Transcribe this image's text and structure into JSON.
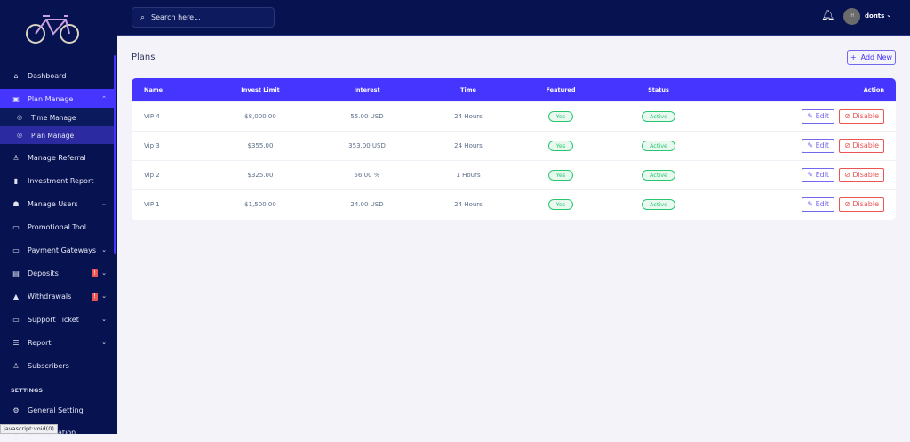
{
  "sidebar": {
    "items": [
      {
        "label": "Dashboard",
        "icon": "home-icon"
      },
      {
        "label": "Plan Manage",
        "icon": "clipboard-icon"
      },
      {
        "label": "Time Manage",
        "icon": "dot-circle-icon"
      },
      {
        "label": "Plan Manage",
        "icon": "dot-circle-icon"
      },
      {
        "label": "Manage Referral",
        "icon": "referral-icon"
      },
      {
        "label": "Investment Report",
        "icon": "chart-icon"
      },
      {
        "label": "Manage Users",
        "icon": "users-icon"
      },
      {
        "label": "Promotional Tool",
        "icon": "promo-icon"
      },
      {
        "label": "Payment Gateways",
        "icon": "credit-card-icon"
      },
      {
        "label": "Deposits",
        "icon": "file-icon",
        "badge": "!"
      },
      {
        "label": "Withdrawals",
        "icon": "bank-icon",
        "badge": "!"
      },
      {
        "label": "Support Ticket",
        "icon": "ticket-icon"
      },
      {
        "label": "Report",
        "icon": "list-icon"
      },
      {
        "label": "Subscribers",
        "icon": "thumbs-up-icon"
      },
      {
        "label": "General Setting",
        "icon": "gear-icon"
      },
      {
        "label": "Configuration",
        "icon": "gear-icon"
      }
    ],
    "settings_heading": "SETTINGS"
  },
  "topbar": {
    "search_placeholder": "Search here...",
    "username": "donts",
    "avatar_text": "IH"
  },
  "page": {
    "title": "Plans",
    "add_new": "Add New"
  },
  "table": {
    "headers": [
      "Name",
      "Invest Limit",
      "Interest",
      "Time",
      "Featured",
      "Status",
      "Action"
    ],
    "rows": [
      {
        "name": "VIP 4",
        "limit": "$8,000.00",
        "interest": "55.00 USD",
        "time": "24 Hours",
        "featured": "Yes",
        "status": "Active"
      },
      {
        "name": "Vip 3",
        "limit": "$355.00",
        "interest": "353.00 USD",
        "time": "24 Hours",
        "featured": "Yes",
        "status": "Active"
      },
      {
        "name": "Vip 2",
        "limit": "$325.00",
        "interest": "56.00 %",
        "time": "1 Hours",
        "featured": "Yes",
        "status": "Active"
      },
      {
        "name": "VIP 1",
        "limit": "$1,500.00",
        "interest": "24.00 USD",
        "time": "24 Hours",
        "featured": "Yes",
        "status": "Active"
      }
    ],
    "edit_label": "Edit",
    "disable_label": "Disable"
  },
  "statusbar": "javascript:void(0)",
  "colors": {
    "sidebar": "#071251",
    "accent": "#4634ff",
    "success": "#28c76f",
    "danger": "#ea5455"
  }
}
